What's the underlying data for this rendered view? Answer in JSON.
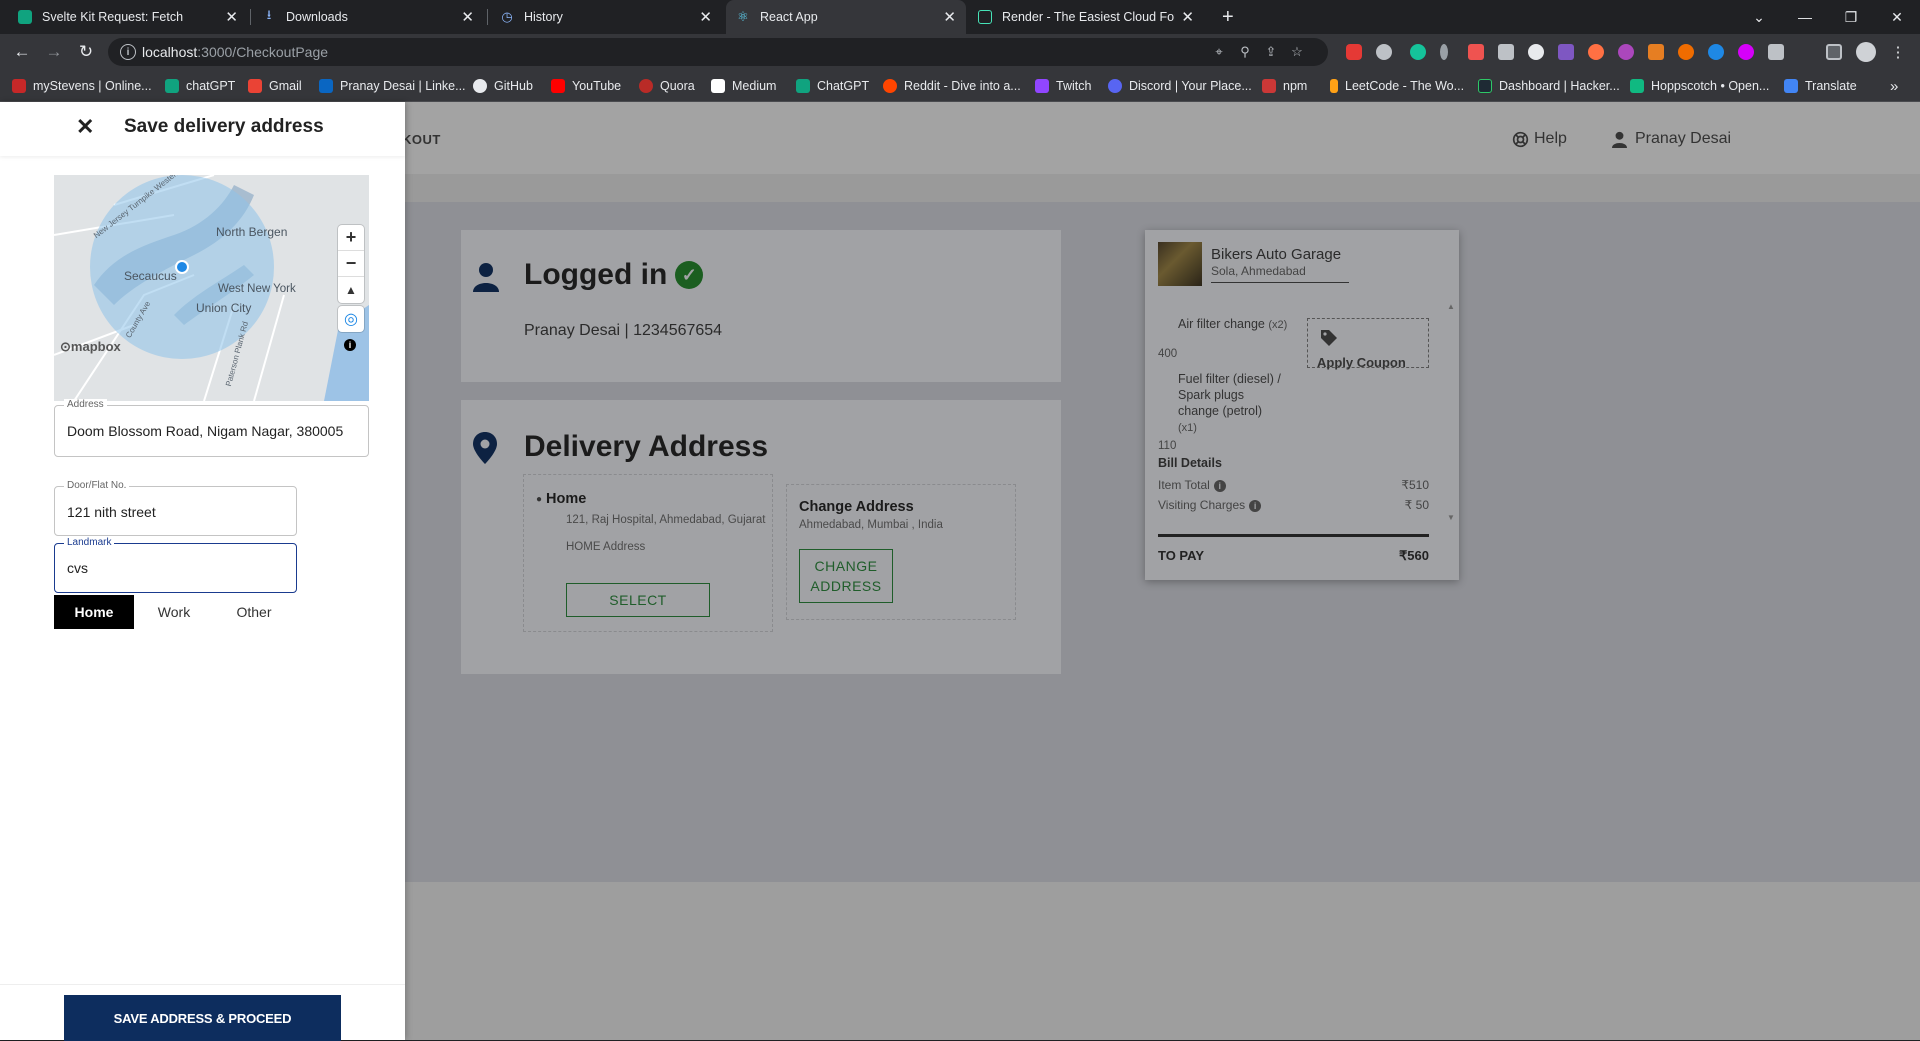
{
  "browser": {
    "tabs": [
      {
        "title": "Svelte Kit Request: Fetch",
        "active": false
      },
      {
        "title": "Downloads",
        "active": false
      },
      {
        "title": "History",
        "active": false
      },
      {
        "title": "React App",
        "active": true
      },
      {
        "title": "Render - The Easiest Cloud For All Your Apps",
        "active": false
      }
    ],
    "new_tab": "+",
    "url_host": "localhost",
    "url_path": ":3000/CheckoutPage",
    "bookmarks": [
      "myStevens | Online...",
      "chatGPT",
      "Gmail",
      "Pranay Desai | Linke...",
      "GitHub",
      "YouTube",
      "Quora",
      "Medium",
      "ChatGPT",
      "Reddit - Dive into a...",
      "Twitch",
      "Discord | Your Place...",
      "npm",
      "LeetCode - The Wo...",
      "Dashboard | Hacker...",
      "Hoppscotch • Open...",
      "Translate"
    ]
  },
  "header": {
    "crumb": "KOUT",
    "help": "Help",
    "user": "Pranay Desai"
  },
  "login": {
    "title": "Logged in",
    "subtitle": "Pranay Desai | 1234567654"
  },
  "delivery": {
    "title": "Delivery Address",
    "home": {
      "label": "Home",
      "address": "121, Raj Hospital, Ahmedabad, Gujarat",
      "type": "HOME Address",
      "button": "SELECT"
    },
    "change": {
      "title": "Change Address",
      "subtitle": "Ahmedabad, Mumbai , India",
      "button": "CHANGE ADDRESS"
    }
  },
  "cart": {
    "garage_name": "Bikers Auto Garage",
    "garage_location": "Sola, Ahmedabad",
    "items": [
      {
        "name": "Air filter change",
        "qty": "(x2)",
        "price": "400"
      },
      {
        "name": "Fuel filter (diesel) / Spark plugs change (petrol)",
        "qty": "(x1)",
        "price": "110"
      }
    ],
    "coupon": "Apply Coupon",
    "bill_details": "Bill Details",
    "item_total_label": "Item Total",
    "item_total": "₹510",
    "visiting_label": "Visiting Charges",
    "visiting": "₹ 50",
    "to_pay_label": "TO PAY",
    "to_pay": "₹560"
  },
  "drawer": {
    "title": "Save delivery address",
    "map_labels": {
      "north_bergen": "North Bergen",
      "secaucus": "Secaucus",
      "west_new_york": "West New York",
      "union_city": "Union City",
      "turnpike": "New Jersey Turnpike Western Spur",
      "county_ave": "County Ave",
      "paterson": "Paterson Plank Rd",
      "mapbox": "mapbox"
    },
    "address_label": "Address",
    "address_value": "Doom Blossom Road, Nigam Nagar, 380005",
    "door_label": "Door/Flat No.",
    "door_value": "121 nith street",
    "landmark_label": "Landmark",
    "landmark_value": "cvs",
    "tags": [
      "Home",
      "Work",
      "Other"
    ],
    "save_button": "SAVE ADDRESS & PROCEED"
  }
}
